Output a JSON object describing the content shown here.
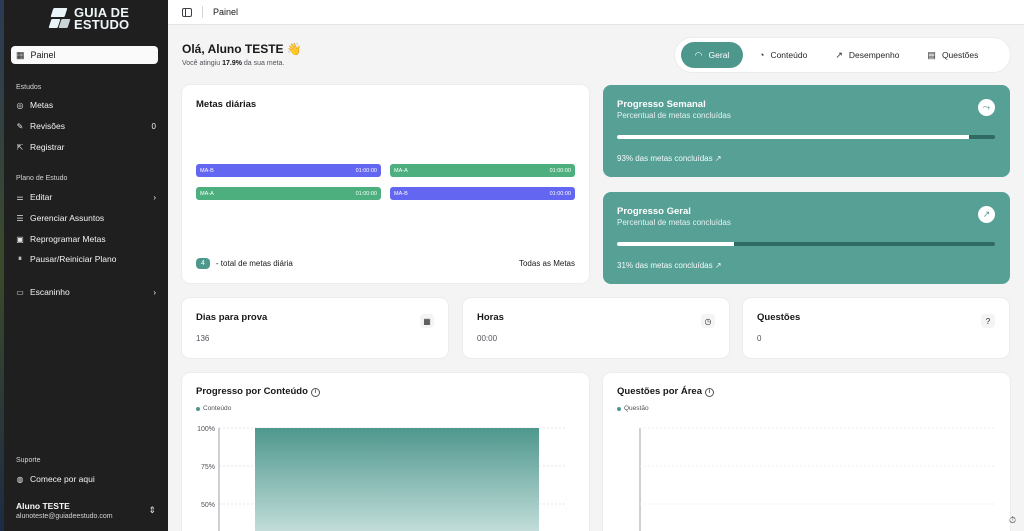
{
  "logo": {
    "line1": "GUIA DE",
    "line2": "ESTUDO"
  },
  "sidebar": {
    "active_item": {
      "label": "Painel",
      "icon": "grid-icon"
    },
    "sections": [
      {
        "title": "Estudos"
      },
      {
        "title": "Plano de Estudo"
      },
      {
        "title": "Suporte"
      }
    ],
    "items": [
      {
        "label": "Metas",
        "icon": "target-icon"
      },
      {
        "label": "Revisões",
        "icon": "edit-doc-icon",
        "count": "0"
      },
      {
        "label": "Registrar",
        "icon": "export-icon"
      },
      {
        "label": "Editar",
        "icon": "sliders-icon",
        "chevron": "›"
      },
      {
        "label": "Gerenciar Assuntos",
        "icon": "list-icon"
      },
      {
        "label": "Reprogramar Metas",
        "icon": "calendar-clock-icon"
      },
      {
        "label": "Pausar/Reiniciar Plano",
        "icon": "pause-icon"
      },
      {
        "label": "Escaninho",
        "icon": "inbox-icon",
        "chevron": "›"
      },
      {
        "label": "Comece por aqui",
        "icon": "help-circle-icon"
      }
    ],
    "user": {
      "name": "Aluno TESTE",
      "email": "alunoteste@guiadeestudo.com"
    }
  },
  "topbar": {
    "title": "Painel"
  },
  "greeting": {
    "title": "Olá, Aluno TESTE 👋",
    "sub_prefix": "Você atingiu ",
    "sub_value": "17.9%",
    "sub_suffix": " da sua meta."
  },
  "tabs": [
    {
      "label": "Geral",
      "icon": "gauge-icon",
      "active": true
    },
    {
      "label": "Conteúdo",
      "icon": "pie-chart-icon",
      "active": false
    },
    {
      "label": "Desempenho",
      "icon": "trend-up-icon",
      "active": false
    },
    {
      "label": "Questões",
      "icon": "list-box-icon",
      "active": false
    }
  ],
  "metas_diarias": {
    "title": "Metas diárias",
    "chips": [
      {
        "label": "MA-B",
        "time": "01:00:00",
        "color": "#6366f1"
      },
      {
        "label": "MA-A",
        "time": "01:00:00",
        "color": "#4caf7d"
      },
      {
        "label": "MA-A",
        "time": "01:00:00",
        "color": "#4caf7d"
      },
      {
        "label": "MA-B",
        "time": "01:00:00",
        "color": "#6366f1"
      }
    ],
    "total_count": "4",
    "total_label": "- total de metas diária",
    "all_link": "Todas as Metas"
  },
  "progress_cards": [
    {
      "title": "Progresso Semanal",
      "subtitle": "Percentual de metas concluídas",
      "value": 0.93,
      "footer": "93% das metas concluídas",
      "icon": "share-icon"
    },
    {
      "title": "Progresso Geral",
      "subtitle": "Percentual de metas concluídas",
      "value": 0.31,
      "footer": "31% das metas concluídas",
      "icon": "trend-up-icon"
    }
  ],
  "stats": [
    {
      "title": "Dias para prova",
      "value": "136",
      "icon": "calendar-icon"
    },
    {
      "title": "Horas",
      "value": "00:00",
      "icon": "clock-icon"
    },
    {
      "title": "Questões",
      "value": "0",
      "icon": "message-question-icon"
    }
  ],
  "charts": {
    "conteudo": {
      "title": "Progresso por Conteúdo",
      "legend": "Conteúdo"
    },
    "area": {
      "title": "Questões por Área",
      "legend": "Questão"
    }
  },
  "chart_data": [
    {
      "type": "bar",
      "categories": [
        ""
      ],
      "series": [
        {
          "name": "Conteúdo",
          "values": [
            100
          ]
        }
      ],
      "ylim": [
        0,
        100
      ],
      "yticks": [
        "100%",
        "75%",
        "50%"
      ]
    },
    {
      "type": "bar",
      "categories": [],
      "series": [
        {
          "name": "Questão",
          "values": []
        }
      ]
    }
  ],
  "colors": {
    "accent": "#4e978d",
    "sidebar": "#1f1f1f",
    "chip_blue": "#6366f1",
    "chip_green": "#4caf7d"
  }
}
